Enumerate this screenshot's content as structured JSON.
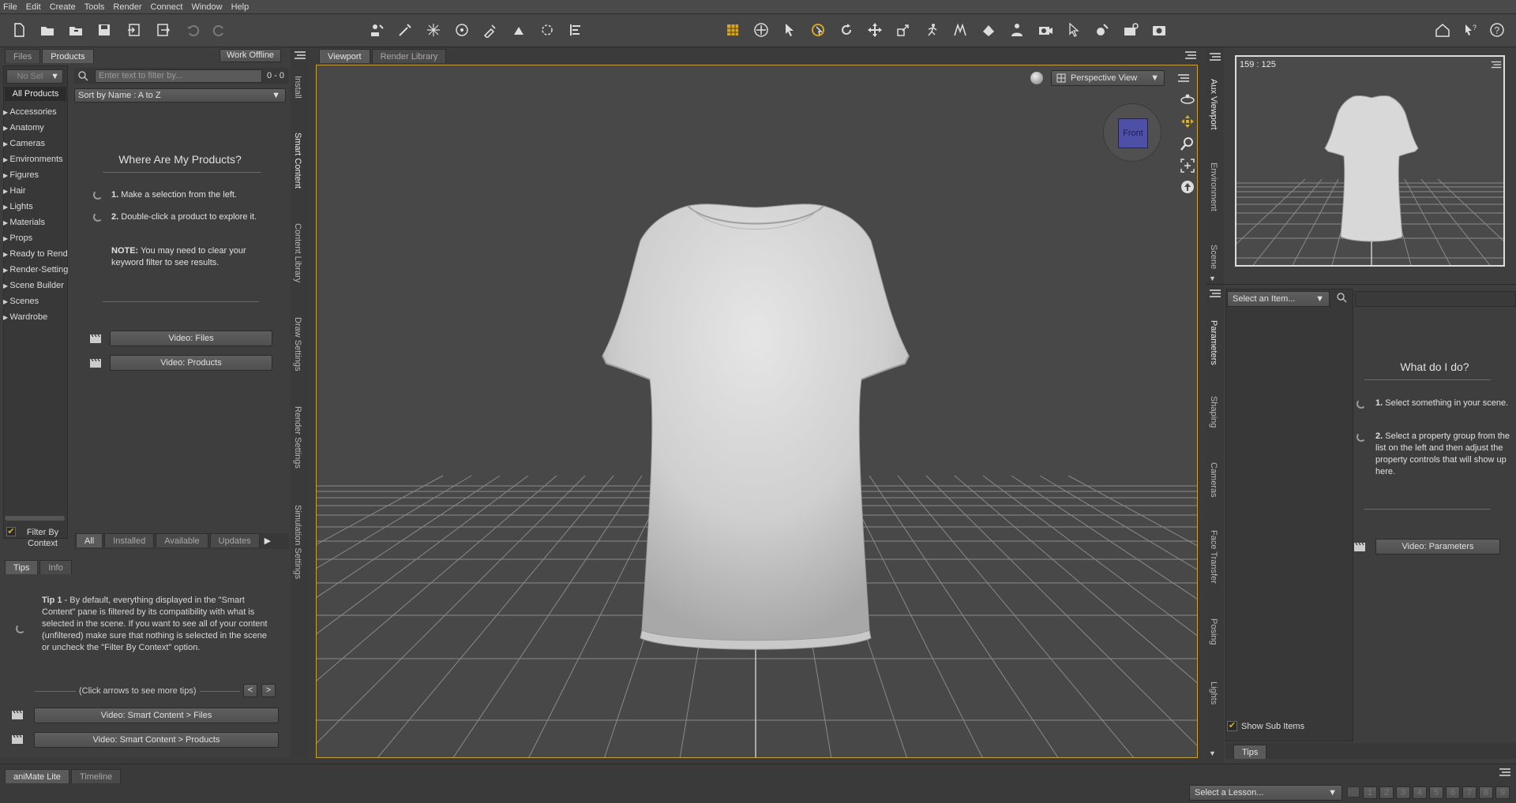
{
  "menu": [
    "File",
    "Edit",
    "Create",
    "Tools",
    "Render",
    "Connect",
    "Window",
    "Help"
  ],
  "left": {
    "tabs": [
      "Files",
      "Products"
    ],
    "work_offline": "Work Offline",
    "filter_dropdown": "No Sel",
    "filter_placeholder": "Enter text to filter by...",
    "filter_count": "0 - 0",
    "all_products": "All Products",
    "sort": "Sort by Name : A to Z",
    "categories": [
      "Accessories",
      "Anatomy",
      "Cameras",
      "Environments",
      "Figures",
      "Hair",
      "Lights",
      "Materials",
      "Props",
      "Ready to Render",
      "Render-Settings",
      "Scene Builder",
      "Scenes",
      "Wardrobe"
    ],
    "where_title": "Where Are My Products?",
    "step1_num": "1.",
    "step1": "Make a selection from the left.",
    "step2_num": "2.",
    "step2": "Double-click a product to explore it.",
    "note_label": "NOTE:",
    "note": "You may need to clear your keyword filter to see results.",
    "video_files": "Video: Files",
    "video_products": "Video: Products",
    "filter_by_context": "Filter By Context",
    "bottom_tabs": [
      "All",
      "Installed",
      "Available",
      "Updates"
    ],
    "vtabs": [
      "Install",
      "Smart Content",
      "Content Library",
      "Draw Settings",
      "Render Settings",
      "Simulation Settings"
    ]
  },
  "tips": {
    "tabs": [
      "Tips",
      "Info"
    ],
    "tip_label": "Tip 1",
    "tip_text": " - By default, everything displayed in the \"Smart Content\" pane is filtered by its compatibility with what is selected in the scene. If you want to see all of your content (unfiltered) make sure that nothing is selected in the scene or uncheck the \"Filter By Context\" option.",
    "arrows_hint": "(Click arrows to see more tips)",
    "prev": "<",
    "next": ">",
    "video_sc_files": "Video: Smart Content > Files",
    "video_sc_products": "Video: Smart Content > Products"
  },
  "viewport": {
    "tabs": [
      "Viewport",
      "Render Library"
    ],
    "view_label": "Perspective View",
    "cube_label": "Front"
  },
  "right": {
    "aux_coords": "159 : 125",
    "vtabs_top": [
      "Aux Viewport",
      "Environment",
      "Scene"
    ],
    "vtabs_bottom": [
      "Parameters",
      "Shaping",
      "Cameras",
      "Face Transfer",
      "Posing",
      "Lights"
    ],
    "select_item": "Select an Item...",
    "what_title": "What do I do?",
    "step1_num": "1.",
    "step1": "Select something in your scene.",
    "step2_num": "2.",
    "step2": "Select a property group from the list on the left and then adjust the property controls that will show up here.",
    "video_params": "Video: Parameters",
    "show_sub": "Show Sub Items",
    "tips_tab": "Tips"
  },
  "bottom": {
    "tabs": [
      "aniMate Lite",
      "Timeline"
    ],
    "lesson": "Select a Lesson...",
    "pages": [
      "1",
      "2",
      "3",
      "4",
      "5",
      "6",
      "7",
      "8",
      "9"
    ]
  },
  "colors": {
    "accent": "#c9a23c",
    "viewport_bg": "#484848",
    "panel": "#3e3e3e"
  }
}
